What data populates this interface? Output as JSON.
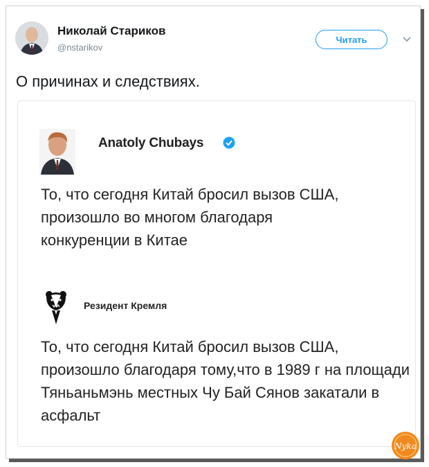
{
  "tweet": {
    "author_name": "Николай Стариков",
    "author_handle": "@nstarikov",
    "follow_label": "Читать",
    "text": "О причинах и следствиях."
  },
  "embed": {
    "post1": {
      "name": "Anatoly Chubays",
      "text": "То, что сегодня Китай бросил вызов США, произошло во многом благодаря конкуренции в Китае"
    },
    "post2": {
      "name": "Резидент Кремля",
      "text": "То, что сегодня Китай бросил вызов США, произошло благодаря тому,что в 1989 г на площади Тяньаньмэнь местных Чу Бай Сянов закатали в асфальт"
    }
  },
  "watermark": {
    "text": "Nyka"
  },
  "colors": {
    "accent": "#1da1f2",
    "verified": "#1da1f2",
    "text": "#14171a",
    "muted": "#7a8a96",
    "watermark": "#f08a1e"
  }
}
